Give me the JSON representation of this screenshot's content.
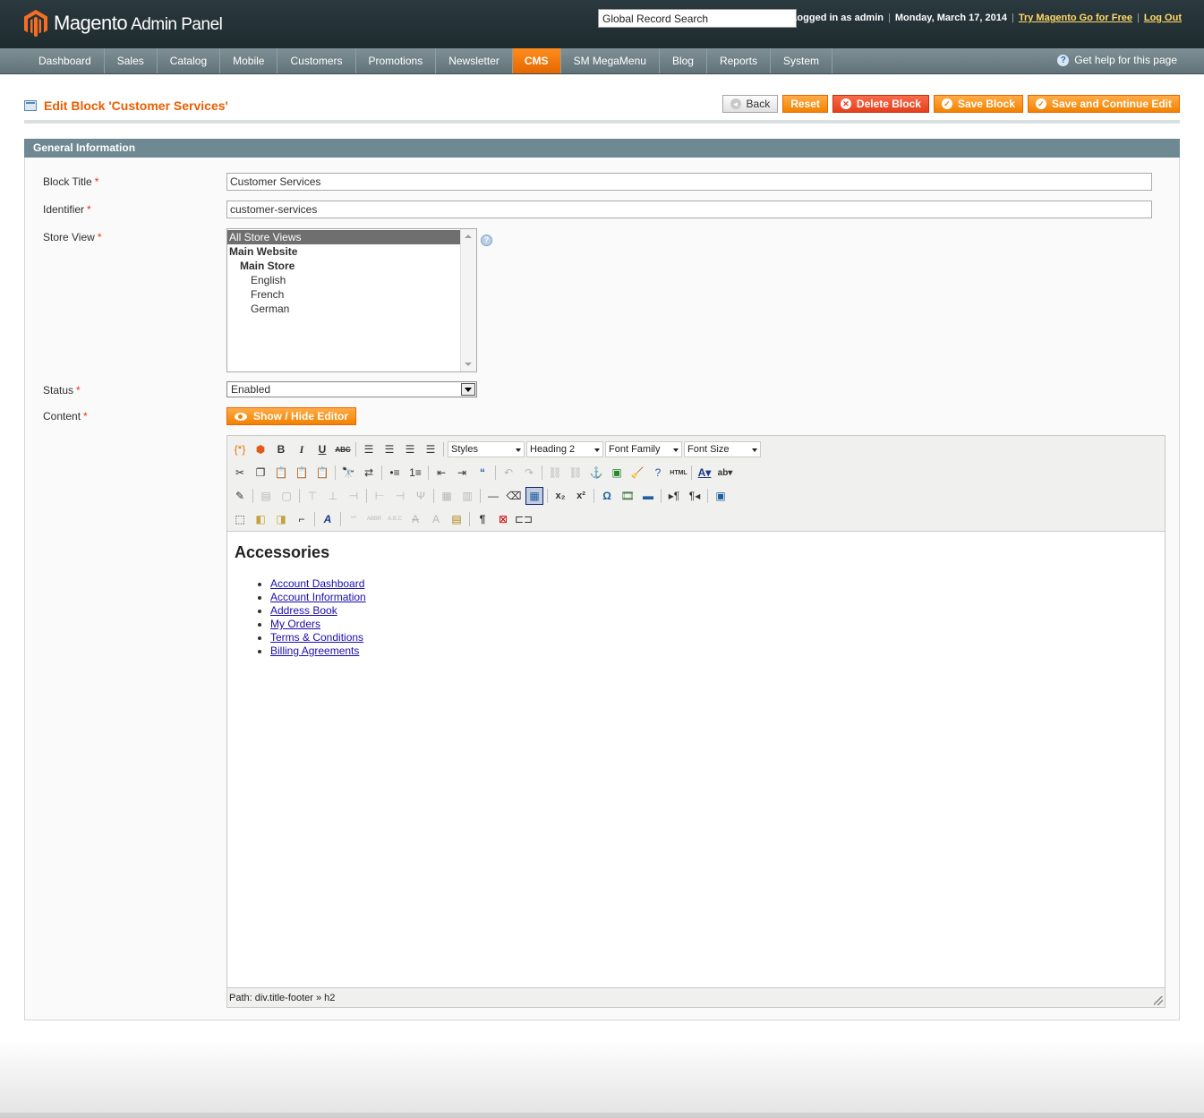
{
  "header": {
    "logo_brand": "Magento",
    "logo_product": "Admin Panel",
    "search_value": "Global Record Search",
    "logged_in": "Logged in as admin",
    "date": "Monday, March 17, 2014",
    "try_link": "Try Magento Go for Free",
    "logout": "Log Out"
  },
  "nav": {
    "items": [
      "Dashboard",
      "Sales",
      "Catalog",
      "Mobile",
      "Customers",
      "Promotions",
      "Newsletter",
      "CMS",
      "SM MegaMenu",
      "Blog",
      "Reports",
      "System"
    ],
    "active": "CMS",
    "help": "Get help for this page"
  },
  "page": {
    "title": "Edit Block 'Customer Services'",
    "buttons": {
      "back": "Back",
      "reset": "Reset",
      "delete": "Delete Block",
      "save": "Save Block",
      "save_continue": "Save and Continue Edit"
    }
  },
  "form": {
    "section_title": "General Information",
    "block_title_label": "Block Title",
    "block_title_value": "Customer Services",
    "identifier_label": "Identifier",
    "identifier_value": "customer-services",
    "store_view_label": "Store View",
    "store_options": [
      "All Store Views",
      "Main Website",
      "Main Store",
      "English",
      "French",
      "German"
    ],
    "status_label": "Status",
    "status_value": "Enabled",
    "content_label": "Content",
    "toggle_editor": "Show / Hide Editor",
    "required_mark": "*"
  },
  "editor": {
    "selects": {
      "styles": "Styles",
      "format": "Heading 2",
      "font_family": "Font Family",
      "font_size": "Font Size"
    },
    "heading": "Accessories",
    "links": [
      "Account Dashboard",
      "Account Information",
      "Address Book",
      "My Orders",
      "Terms & Conditions",
      "Billing Agreements"
    ],
    "path": "Path: div.title-footer » h2"
  },
  "colors": {
    "accent": "#eb5e00",
    "nav_bg": "#6f8992",
    "header_bg": "#2b3a3f"
  }
}
